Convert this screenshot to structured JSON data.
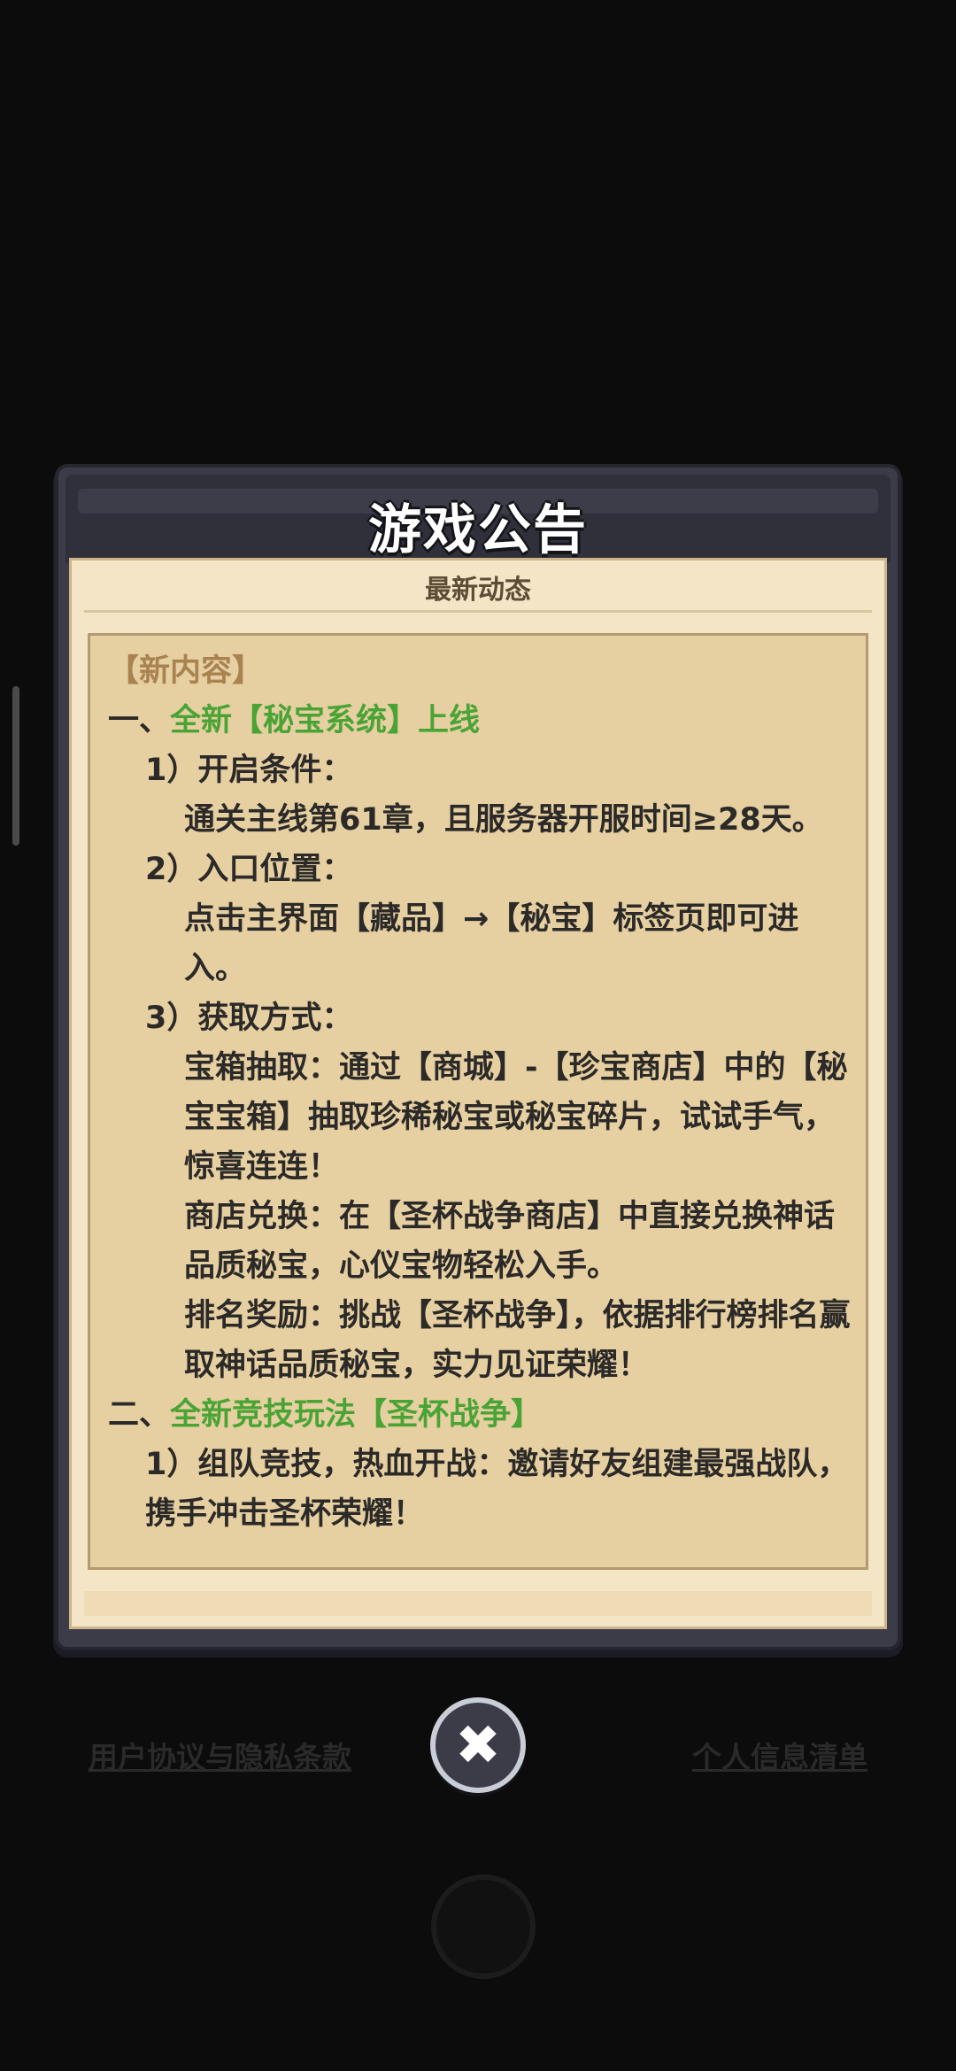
{
  "modal": {
    "title": "游戏公告",
    "subtitle": "最新动态",
    "lines": [
      {
        "text": "【新内容】",
        "cls": "c-header"
      },
      {
        "text": "",
        "cls": "",
        "parts": [
          "一、",
          "全新【秘宝系统】上线"
        ]
      },
      {
        "text": "1）开启条件：",
        "cls": "ind1"
      },
      {
        "text": "通关主线第61章，且服务器开服时间≥28天。",
        "cls": "ind2"
      },
      {
        "text": "2）入口位置：",
        "cls": "ind1"
      },
      {
        "text": "点击主界面【藏品】→【秘宝】标签页即可进入。",
        "cls": "ind2"
      },
      {
        "text": "3）获取方式：",
        "cls": "ind1"
      },
      {
        "text": "宝箱抽取：通过【商城】-【珍宝商店】中的【秘宝宝箱】抽取珍稀秘宝或秘宝碎片，试试手气，惊喜连连！",
        "cls": "ind2"
      },
      {
        "text": "商店兑换：在【圣杯战争商店】中直接兑换神话品质秘宝，心仪宝物轻松入手。",
        "cls": "ind2"
      },
      {
        "text": "排名奖励：挑战【圣杯战争】，依据排行榜排名赢取神话品质秘宝，实力见证荣耀！",
        "cls": "ind2"
      },
      {
        "text": "",
        "cls": "",
        "parts": [
          "二、",
          "全新竞技玩法【圣杯战争】"
        ]
      },
      {
        "text": "1）组队竞技，热血开战：邀请好友组建最强战队，携手冲击圣杯荣耀！",
        "cls": "ind1"
      }
    ]
  },
  "footer": {
    "left_link": "用户协议与隐私条款",
    "right_link": "个人信息清单"
  },
  "close_icon": "close-icon"
}
